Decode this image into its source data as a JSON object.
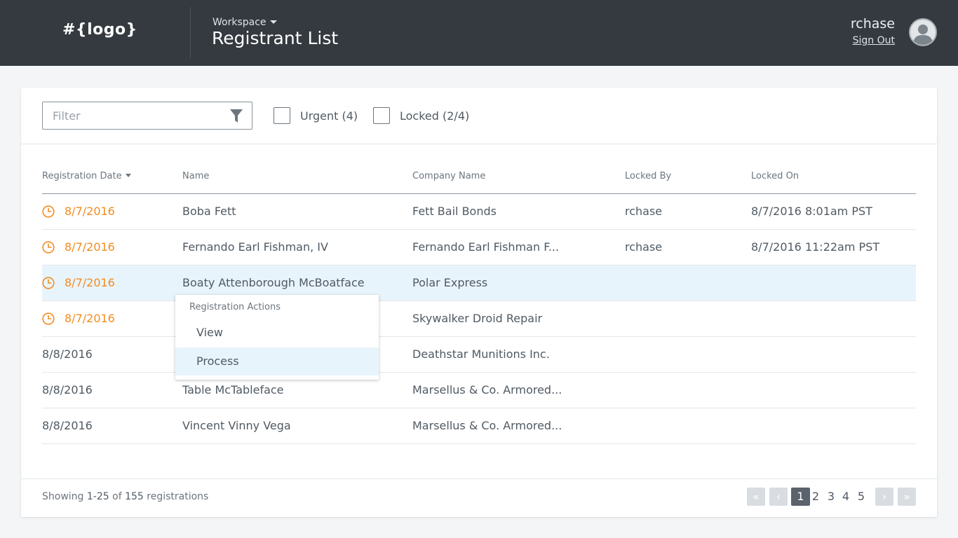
{
  "header": {
    "logo": "#{logo}",
    "workspace_label": "Workspace",
    "title": "Registrant List",
    "username": "rchase",
    "signout_label": "Sign Out",
    "avatar_icon": "user-avatar-icon"
  },
  "toolbar": {
    "filter_placeholder": "Filter",
    "filter_value": "",
    "filter_icon": "funnel-icon",
    "urgent_label": "Urgent (4)",
    "urgent_checked": false,
    "locked_label": "Locked (2/4)",
    "locked_checked": false
  },
  "table": {
    "columns": [
      "Registration Date",
      "Name",
      "Company Name",
      "Locked By",
      "Locked On"
    ],
    "sorted_column": "Registration Date",
    "rows": [
      {
        "date": "8/7/2016",
        "name": "Boba Fett",
        "company": "Fett Bail Bonds",
        "locked_by": "rchase",
        "locked_on": "8/7/2016 8:01am PST",
        "urgent": true
      },
      {
        "date": "8/7/2016",
        "name": "Fernando Earl Fishman, IV",
        "company": "Fernando Earl Fishman F...",
        "locked_by": "rchase",
        "locked_on": "8/7/2016 11:22am PST",
        "urgent": true
      },
      {
        "date": "8/7/2016",
        "name": "Boaty Attenborough McBoatface",
        "company": "Polar Express",
        "locked_by": "",
        "locked_on": "",
        "urgent": true,
        "highlighted": true
      },
      {
        "date": "8/7/2016",
        "name": "",
        "company": "Skywalker Droid Repair",
        "locked_by": "",
        "locked_on": "",
        "urgent": true
      },
      {
        "date": "8/8/2016",
        "name": "",
        "company": "Deathstar Munitions Inc.",
        "locked_by": "",
        "locked_on": "",
        "urgent": false
      },
      {
        "date": "8/8/2016",
        "name": "Table McTableface",
        "company": "Marsellus & Co. Armored...",
        "locked_by": "",
        "locked_on": "",
        "urgent": false
      },
      {
        "date": "8/8/2016",
        "name": "Vincent Vinny Vega",
        "company": "Marsellus & Co. Armored...",
        "locked_by": "",
        "locked_on": "",
        "urgent": false
      }
    ]
  },
  "context_menu": {
    "title": "Registration Actions",
    "items": [
      "View",
      "Process"
    ],
    "active_item": "Process"
  },
  "footer": {
    "showing_prefix": "Showing",
    "range": "1-25",
    "of_word": "of",
    "total": "155",
    "suffix": "registrations"
  },
  "pagination": {
    "first": "«",
    "prev": "‹",
    "pages": [
      "1",
      "2",
      "3",
      "4",
      "5"
    ],
    "current": "1",
    "next": "›",
    "last": "»"
  },
  "colors": {
    "header_bg": "#343a40",
    "urgent": "#f38b1e",
    "row_highlight": "#e8f4fc",
    "current_page": "#5a636b"
  }
}
